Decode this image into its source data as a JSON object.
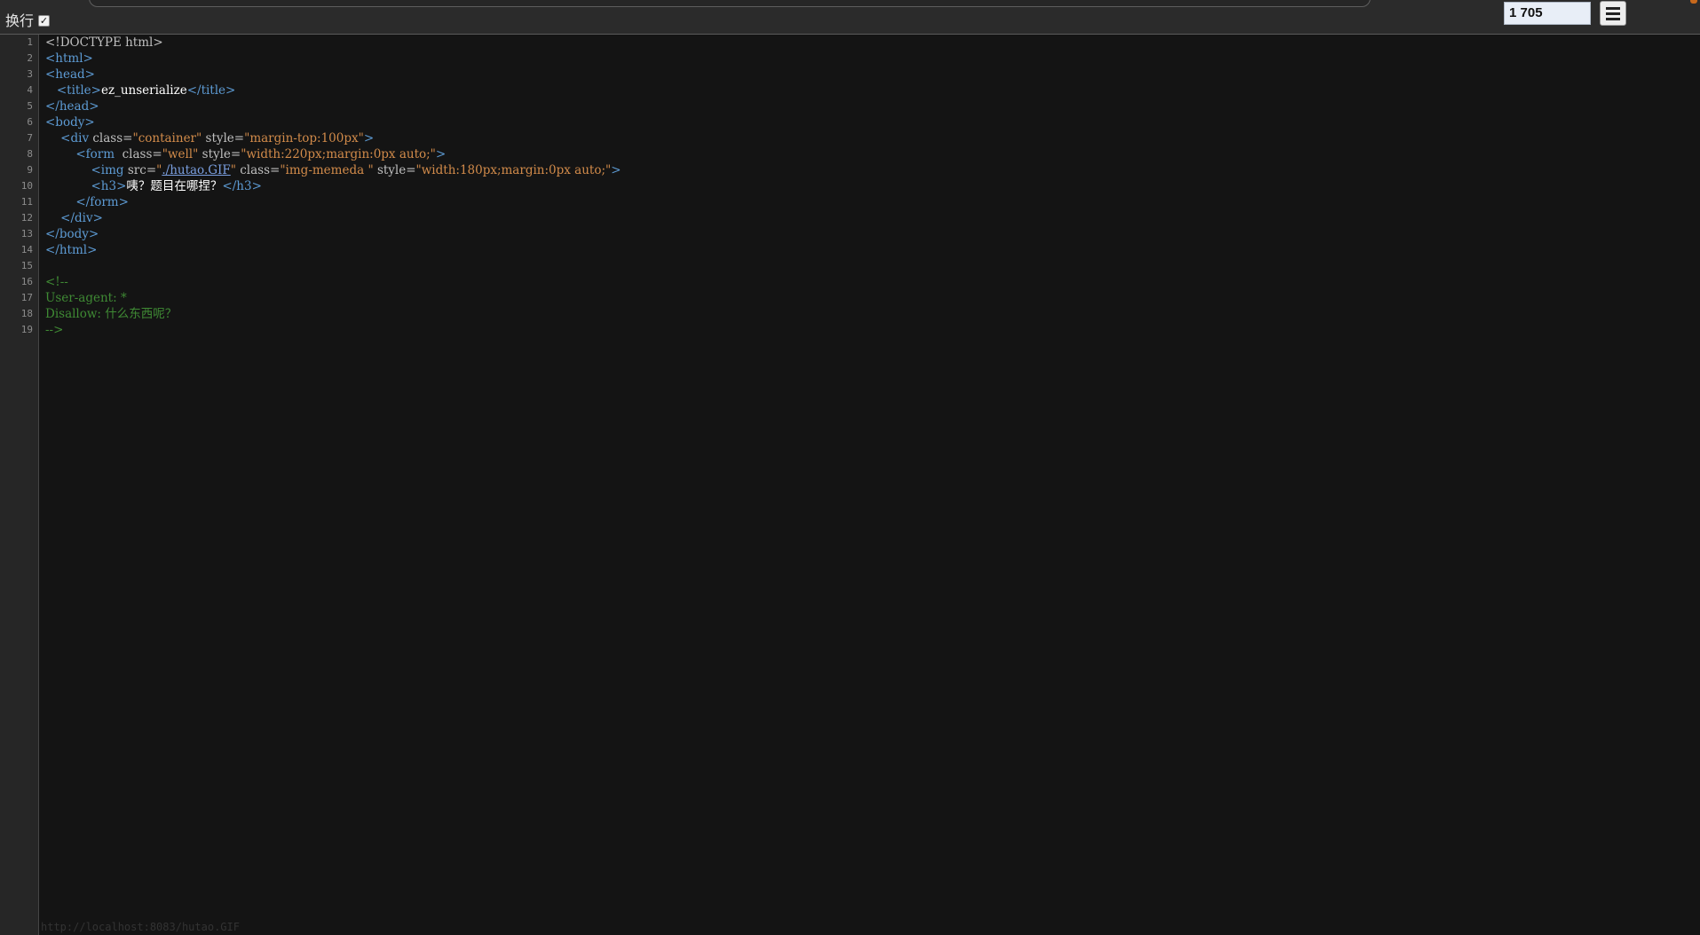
{
  "toolbar": {
    "wrap_label": "换行",
    "wrap_checked": true,
    "line_input_value": "1 705",
    "menu_icon": "hamburger-menu-icon"
  },
  "gutter": {
    "line_numbers": [
      "1",
      "2",
      "3",
      "4",
      "5",
      "6",
      "7",
      "8",
      "9",
      "10",
      "11",
      "12",
      "13",
      "14",
      "15",
      "16",
      "17",
      "18",
      "19"
    ]
  },
  "code": {
    "l1": {
      "doctype": "<!DOCTYPE html>"
    },
    "l2": {
      "tag": "<html>"
    },
    "l3": {
      "tag": "<head>"
    },
    "l4": {
      "indent": "   ",
      "open": "<title>",
      "text": "ez_unserialize",
      "close": "</title>"
    },
    "l5": {
      "tag": "</head>"
    },
    "l6": {
      "tag": "<body>"
    },
    "l7": {
      "indent": "    ",
      "open": "<div ",
      "a1": "class=",
      "v1": "\"container\"",
      "a2": " style=",
      "v2": "\"margin-top:100px\"",
      "end": ">"
    },
    "l8": {
      "indent": "        ",
      "open": "<form  ",
      "a1": "class=",
      "v1": "\"well\"",
      "a2": " style=",
      "v2": "\"width:220px;margin:0px auto;\"",
      "end": ">"
    },
    "l9": {
      "indent": "            ",
      "open": "<img ",
      "a1": "src=",
      "q1": "\"",
      "link": "./hutao.GIF",
      "q2": "\"",
      "a2": " class=",
      "v2": "\"img-memeda \"",
      "a3": " style=",
      "v3": "\"width:180px;margin:0px auto;\"",
      "end": ">"
    },
    "l10": {
      "indent": "            ",
      "open": "<h3>",
      "text": "咦？题目在哪捏？",
      "close": "</h3>"
    },
    "l11": {
      "indent": "        ",
      "tag": "</form>"
    },
    "l12": {
      "indent": "    ",
      "tag": "</div>"
    },
    "l13": {
      "tag": "</body>"
    },
    "l14": {
      "tag": "</html>"
    },
    "l16": {
      "comment": "<!--"
    },
    "l17": {
      "comment": "User-agent: *"
    },
    "l18": {
      "comment": "Disallow: 什么东西呢？"
    },
    "l19": {
      "comment": "-->"
    }
  },
  "status_text": "http://localhost:8083/hutao.GIF",
  "colors": {
    "background": "#141414",
    "tag": "#5d9bd4",
    "attr_value": "#d28b4a",
    "comment": "#3f8a34",
    "text": "#ffffff"
  }
}
